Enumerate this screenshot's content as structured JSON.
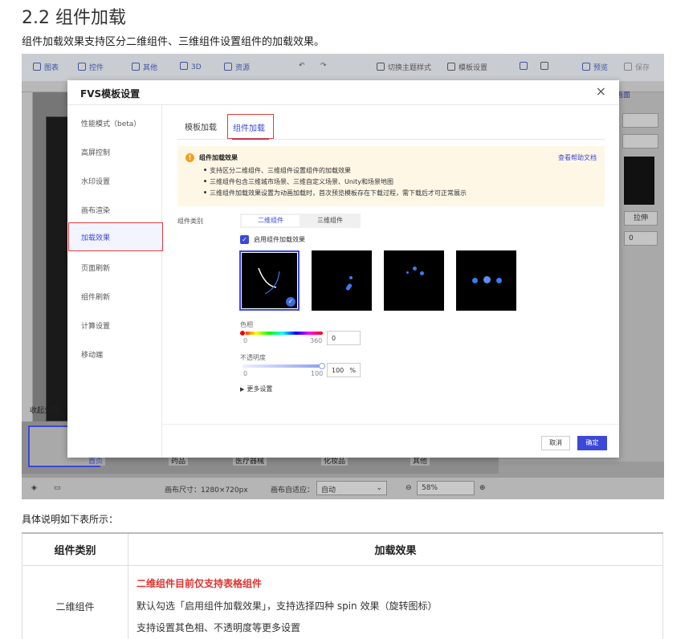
{
  "heading": "2.2 组件加载",
  "intro": "组件加载效果支持区分二维组件、三维组件设置组件的加载效果。",
  "toolbar": {
    "items": [
      "图表",
      "控件",
      "其他",
      "3D",
      "资源"
    ],
    "right_items": [
      "切换主题样式",
      "模板设置",
      "预览",
      "保存"
    ]
  },
  "modal": {
    "title": "FVS模板设置",
    "close": "×",
    "sidebar": [
      "性能模式（beta）",
      "高屏控制",
      "水印设置",
      "画布渲染",
      "加载效果",
      "页面刷新",
      "组件刷新",
      "计算设置",
      "移动端"
    ],
    "tabs": [
      "模板加载",
      "组件加载"
    ],
    "notice": {
      "icon": "!",
      "title": "组件加载效果",
      "link": "查看帮助文档",
      "items": [
        "支持区分二维组件、三维组件设置组件的加载效果",
        "三维组件包含三维城市场景、三维自定义场景、Unity和场景地图",
        "三维组件加载效果设置为动画加载时，首次预览模板存在下载过程，需下载后才可正常展示"
      ]
    },
    "type_label": "组件类别",
    "segments": [
      "二维组件",
      "三维组件"
    ],
    "enable_label": "启用组件加载效果",
    "hue_label": "色相",
    "hue_min": "0",
    "hue_max": "360",
    "hue_value": "0",
    "opacity_label": "不透明度",
    "opacity_min": "0",
    "opacity_max": "100",
    "opacity_value": "100",
    "opacity_unit": "%",
    "more": "更多设置",
    "cancel": "取消",
    "ok": "确定",
    "accent_color": "#3b48d8"
  },
  "bg": {
    "right_btn": "拉伸",
    "right_num": "0",
    "right_head": "画面",
    "collapse": "收起分页",
    "thumbs": [
      "首页",
      "药品",
      "医疗器械",
      "化妆品",
      "其他"
    ],
    "canvas_size": "画布尺寸：1280×720px",
    "adapt_label": "画布自适应：",
    "adapt_value": "自动",
    "zoom": "58%"
  },
  "desc": "具体说明如下表所示：",
  "table": {
    "headers": [
      "组件类别",
      "加载效果"
    ],
    "row": {
      "type": "二维组件",
      "red": "二维组件目前仅支持表格组件",
      "line2": "默认勾选「启用组件加载效果」，支持选择四种 spin 效果（旋转图标）",
      "line3": "支持设置其色相、不透明度等更多设置"
    }
  }
}
